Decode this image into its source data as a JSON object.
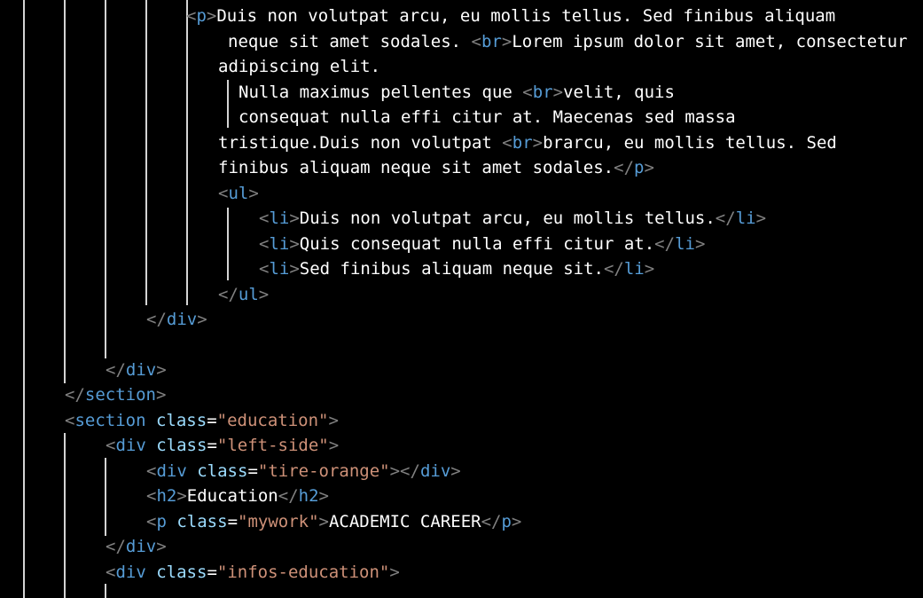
{
  "editor": {
    "colors": {
      "background": "#000000",
      "bracket": "#808080",
      "tag": "#569cd6",
      "attribute": "#9cdcfe",
      "string": "#ce9178",
      "text": "#ffffff",
      "indent_guide": "#d4d4d4"
    },
    "lines": [
      [
        {
          "t": "br",
          "v": "<"
        },
        {
          "t": "tg",
          "v": "p"
        },
        {
          "t": "br",
          "v": ">"
        },
        {
          "t": "tx",
          "v": "Duis non volutpat arcu, eu mollis tellus. Sed finibus aliquam"
        }
      ],
      [
        {
          "t": "tx",
          "v": "neque sit amet sodales. "
        },
        {
          "t": "br",
          "v": "<"
        },
        {
          "t": "tg",
          "v": "br"
        },
        {
          "t": "br",
          "v": ">"
        },
        {
          "t": "tx",
          "v": "Lorem ipsum dolor sit amet, consectetur"
        }
      ],
      [
        {
          "t": "tx",
          "v": "adipiscing elit."
        }
      ],
      [
        {
          "t": "tx",
          "v": "Nulla maximus pellentes que "
        },
        {
          "t": "br",
          "v": "<"
        },
        {
          "t": "tg",
          "v": "br"
        },
        {
          "t": "br",
          "v": ">"
        },
        {
          "t": "tx",
          "v": "velit, quis"
        }
      ],
      [
        {
          "t": "tx",
          "v": "consequat nulla effi citur at. Maecenas sed massa"
        }
      ],
      [
        {
          "t": "tx",
          "v": "tristique.Duis non volutpat "
        },
        {
          "t": "br",
          "v": "<"
        },
        {
          "t": "tg",
          "v": "br"
        },
        {
          "t": "br",
          "v": ">"
        },
        {
          "t": "tx",
          "v": "brarcu, eu mollis tellus. Sed"
        }
      ],
      [
        {
          "t": "tx",
          "v": "finibus aliquam neque sit amet sodales."
        },
        {
          "t": "br",
          "v": "</"
        },
        {
          "t": "tg",
          "v": "p"
        },
        {
          "t": "br",
          "v": ">"
        }
      ],
      [
        {
          "t": "br",
          "v": "<"
        },
        {
          "t": "tg",
          "v": "ul"
        },
        {
          "t": "br",
          "v": ">"
        }
      ],
      [
        {
          "t": "br",
          "v": "<"
        },
        {
          "t": "tg",
          "v": "li"
        },
        {
          "t": "br",
          "v": ">"
        },
        {
          "t": "tx",
          "v": "Duis non volutpat arcu, eu mollis tellus."
        },
        {
          "t": "br",
          "v": "</"
        },
        {
          "t": "tg",
          "v": "li"
        },
        {
          "t": "br",
          "v": ">"
        }
      ],
      [
        {
          "t": "br",
          "v": "<"
        },
        {
          "t": "tg",
          "v": "li"
        },
        {
          "t": "br",
          "v": ">"
        },
        {
          "t": "tx",
          "v": "Quis consequat nulla effi citur at."
        },
        {
          "t": "br",
          "v": "</"
        },
        {
          "t": "tg",
          "v": "li"
        },
        {
          "t": "br",
          "v": ">"
        }
      ],
      [
        {
          "t": "br",
          "v": "<"
        },
        {
          "t": "tg",
          "v": "li"
        },
        {
          "t": "br",
          "v": ">"
        },
        {
          "t": "tx",
          "v": "Sed finibus aliquam neque sit."
        },
        {
          "t": "br",
          "v": "</"
        },
        {
          "t": "tg",
          "v": "li"
        },
        {
          "t": "br",
          "v": ">"
        }
      ],
      [
        {
          "t": "br",
          "v": "</"
        },
        {
          "t": "tg",
          "v": "ul"
        },
        {
          "t": "br",
          "v": ">"
        }
      ],
      [
        {
          "t": "br",
          "v": "</"
        },
        {
          "t": "tg",
          "v": "div"
        },
        {
          "t": "br",
          "v": ">"
        }
      ],
      [
        {
          "t": "br",
          "v": "</"
        },
        {
          "t": "tg",
          "v": "div"
        },
        {
          "t": "br",
          "v": ">"
        }
      ],
      [
        {
          "t": "br",
          "v": "</"
        },
        {
          "t": "tg",
          "v": "section"
        },
        {
          "t": "br",
          "v": ">"
        }
      ],
      [
        {
          "t": "br",
          "v": "<"
        },
        {
          "t": "tg",
          "v": "section"
        },
        {
          "t": "tx",
          "v": " "
        },
        {
          "t": "at",
          "v": "class"
        },
        {
          "t": "tx",
          "v": "="
        },
        {
          "t": "st",
          "v": "\"education\""
        },
        {
          "t": "br",
          "v": ">"
        }
      ],
      [
        {
          "t": "br",
          "v": "<"
        },
        {
          "t": "tg",
          "v": "div"
        },
        {
          "t": "tx",
          "v": " "
        },
        {
          "t": "at",
          "v": "class"
        },
        {
          "t": "tx",
          "v": "="
        },
        {
          "t": "st",
          "v": "\"left-side\""
        },
        {
          "t": "br",
          "v": ">"
        }
      ],
      [
        {
          "t": "br",
          "v": "<"
        },
        {
          "t": "tg",
          "v": "div"
        },
        {
          "t": "tx",
          "v": " "
        },
        {
          "t": "at",
          "v": "class"
        },
        {
          "t": "tx",
          "v": "="
        },
        {
          "t": "st",
          "v": "\"tire-orange\""
        },
        {
          "t": "br",
          "v": "></"
        },
        {
          "t": "tg",
          "v": "div"
        },
        {
          "t": "br",
          "v": ">"
        }
      ],
      [
        {
          "t": "br",
          "v": "<"
        },
        {
          "t": "tg",
          "v": "h2"
        },
        {
          "t": "br",
          "v": ">"
        },
        {
          "t": "tx",
          "v": "Education"
        },
        {
          "t": "br",
          "v": "</"
        },
        {
          "t": "tg",
          "v": "h2"
        },
        {
          "t": "br",
          "v": ">"
        }
      ],
      [
        {
          "t": "br",
          "v": "<"
        },
        {
          "t": "tg",
          "v": "p"
        },
        {
          "t": "tx",
          "v": " "
        },
        {
          "t": "at",
          "v": "class"
        },
        {
          "t": "tx",
          "v": "="
        },
        {
          "t": "st",
          "v": "\"mywork\""
        },
        {
          "t": "br",
          "v": ">"
        },
        {
          "t": "tx",
          "v": "ACADEMIC CAREER"
        },
        {
          "t": "br",
          "v": "</"
        },
        {
          "t": "tg",
          "v": "p"
        },
        {
          "t": "br",
          "v": ">"
        }
      ],
      [
        {
          "t": "br",
          "v": "</"
        },
        {
          "t": "tg",
          "v": "div"
        },
        {
          "t": "br",
          "v": ">"
        }
      ],
      [
        {
          "t": "br",
          "v": "<"
        },
        {
          "t": "tg",
          "v": "div"
        },
        {
          "t": "tx",
          "v": " "
        },
        {
          "t": "at",
          "v": "class"
        },
        {
          "t": "tx",
          "v": "="
        },
        {
          "t": "st",
          "v": "\"infos-education\""
        },
        {
          "t": "br",
          "v": ">"
        }
      ]
    ]
  }
}
